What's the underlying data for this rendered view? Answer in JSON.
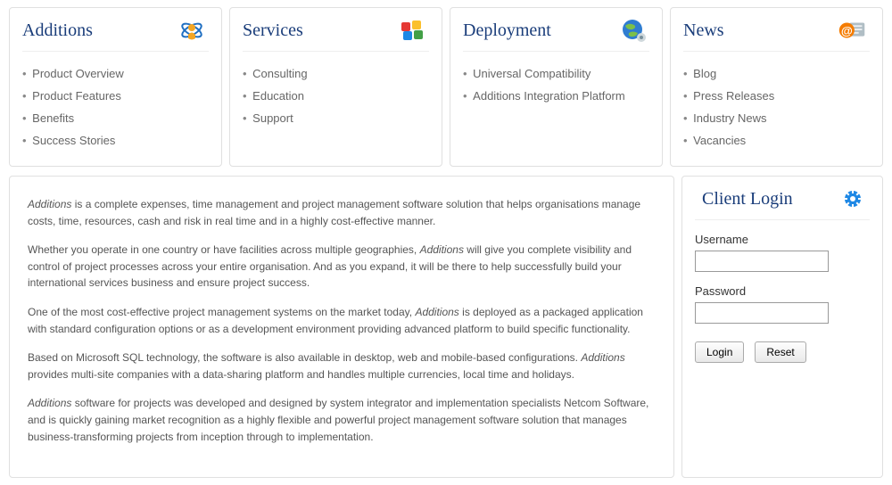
{
  "cards": {
    "additions": {
      "title": "Additions",
      "items": [
        "Product Overview",
        "Product Features",
        "Benefits",
        "Success Stories"
      ]
    },
    "services": {
      "title": "Services",
      "items": [
        "Consulting",
        "Education",
        "Support"
      ]
    },
    "deployment": {
      "title": "Deployment",
      "items": [
        "Universal Compatibility",
        "Additions Integration Platform"
      ]
    },
    "news": {
      "title": "News",
      "items": [
        "Blog",
        "Press Releases",
        "Industry News",
        "Vacancies"
      ]
    }
  },
  "content": {
    "p1_prefix": "Additions",
    "p1_rest": " is a complete expenses, time management and project management software solution that helps organisations manage costs, time, resources, cash and risk in real time and in a highly cost-effective manner.",
    "p2_pre": "Whether you operate in one country or have facilities across multiple geographies, ",
    "p2_em": "Additions",
    "p2_post": " will give you complete visibility and control of project processes across your entire organisation. And as you expand, it will be there to help successfully build your international services business and ensure project success.",
    "p3_pre": "One of the most cost-effective project management systems on the market today, ",
    "p3_em": "Additions",
    "p3_post": " is deployed as a packaged application with standard configuration options or as a development environment providing advanced platform to build specific functionality.",
    "p4_pre": "Based on Microsoft SQL technology, the software is also available in desktop, web and mobile-based configurations. ",
    "p4_em": "Additions",
    "p4_post": " provides multi-site companies with a data-sharing platform and handles multiple currencies, local time and holidays.",
    "p5_em": "Additions",
    "p5_post": " software for projects was developed and designed by system integrator and implementation specialists Netcom Software, and is quickly gaining market recognition as a highly flexible and powerful project management software solution that manages business-transforming projects from inception through to implementation."
  },
  "login": {
    "title": "Client Login",
    "username_label": "Username",
    "password_label": "Password",
    "login_btn": "Login",
    "reset_btn": "Reset"
  }
}
